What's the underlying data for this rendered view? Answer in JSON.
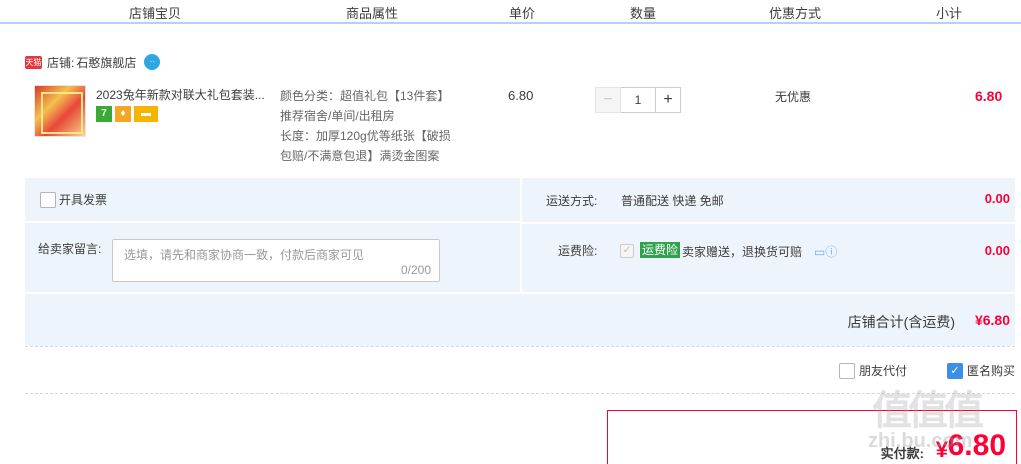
{
  "columns": [
    {
      "label": "店铺宝贝"
    },
    {
      "label": "商品属性"
    },
    {
      "label": "单价"
    },
    {
      "label": "数量"
    },
    {
      "label": "优惠方式"
    },
    {
      "label": "小计"
    }
  ],
  "shop": {
    "badge": "天猫",
    "label": "店铺:",
    "name": "石憨旗舰店",
    "ww_icon": "wangwang-chat-icon"
  },
  "item": {
    "title": "2023兔年新款对联大礼包套装...",
    "badges": [
      "7",
      "G",
      "card"
    ],
    "attributes": [
      "颜色分类：超值礼包【13件套】",
      "推荐宿舍/单间/出租房",
      "长度：加厚120g优等纸张【破损",
      "包赔/不满意包退】满烫金图案"
    ],
    "unit_price": "6.80",
    "quantity": "1",
    "minus": "−",
    "plus": "+",
    "discount": "无优惠",
    "subtotal": "6.80"
  },
  "options": {
    "invoice_label": "开具发票",
    "message_label": "给卖家留言:",
    "message_placeholder": "选填，请先和商家协商一致，付款后商家可见",
    "message_count": "0/200",
    "shipping_label": "运送方式:",
    "shipping_value": "普通配送 快递 免邮",
    "shipping_fee": "0.00",
    "insurance_label": "运费险:",
    "insurance_tag": "运费险",
    "insurance_text": "卖家赠送，退换货可赔",
    "insurance_fee": "0.00",
    "shop_total_label": "店铺合计(含运费)",
    "shop_total_value": "¥6.80"
  },
  "footer": {
    "friend_pay_label": "朋友代付",
    "anonymous_label": "匿名购买",
    "anonymous_checked": true,
    "pay_label": "实付款:",
    "pay_currency": "¥",
    "pay_value": "6.80",
    "watermark": "值值值",
    "watermark_sub": "zhi.bu.com"
  },
  "colors": {
    "accent_red": "#ff0036",
    "header_line": "#b2d1ff",
    "panel_bg": "#eef4fb",
    "checkbox_blue": "#3b8fe6"
  }
}
